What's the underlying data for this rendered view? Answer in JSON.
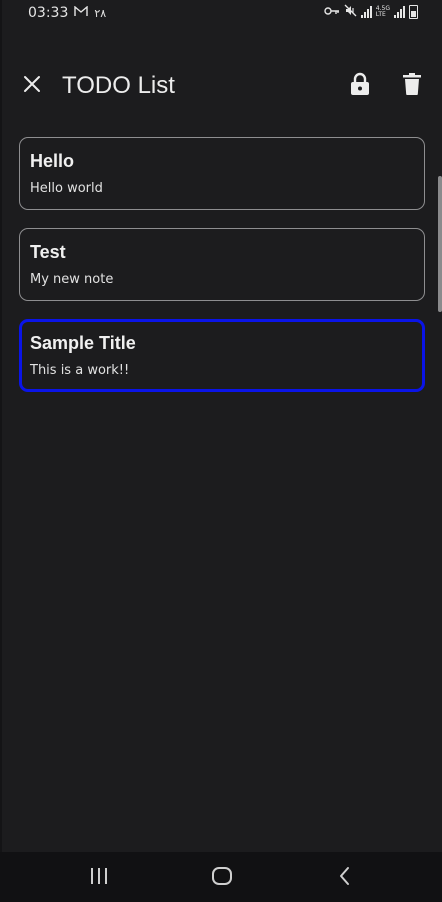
{
  "status_bar": {
    "time": "03:33",
    "date": "٢٨",
    "icons": [
      "gmail-icon",
      "vpn-key-icon",
      "mute-icon",
      "signal-icon",
      "4g-icon",
      "signal-icon",
      "battery-icon"
    ],
    "network_label_top": "4.5G",
    "network_label_bottom": "LTE"
  },
  "app_bar": {
    "title": "TODO List",
    "close_icon": "close-icon",
    "lock_icon": "lock-icon",
    "delete_icon": "trash-icon"
  },
  "notes": [
    {
      "title": "Hello",
      "body": "Hello world",
      "selected": false
    },
    {
      "title": "Test",
      "body": "My new note",
      "selected": false
    },
    {
      "title": "Sample Title",
      "body": "This is a work!!",
      "selected": true
    }
  ],
  "colors": {
    "background": "#1c1c1e",
    "card_border": "#8e8e90",
    "selected_border": "#0a14e8",
    "text": "#ececec"
  },
  "nav_bar": {
    "icons": [
      "recent-apps-icon",
      "home-icon",
      "back-icon"
    ]
  }
}
